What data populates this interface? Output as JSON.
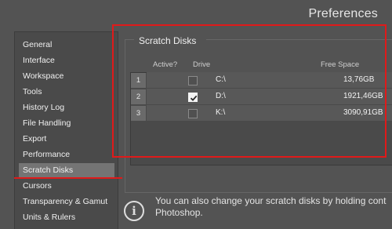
{
  "window": {
    "title": "Preferences"
  },
  "sidebar": {
    "items": [
      {
        "label": "General"
      },
      {
        "label": "Interface"
      },
      {
        "label": "Workspace"
      },
      {
        "label": "Tools"
      },
      {
        "label": "History Log"
      },
      {
        "label": "File Handling"
      },
      {
        "label": "Export"
      },
      {
        "label": "Performance"
      },
      {
        "label": "Scratch Disks",
        "active": true
      },
      {
        "label": "Cursors"
      },
      {
        "label": "Transparency & Gamut"
      },
      {
        "label": "Units & Rulers"
      }
    ]
  },
  "scratch": {
    "title": "Scratch Disks",
    "headers": {
      "active": "Active?",
      "drive": "Drive",
      "free": "Free Space"
    },
    "rows": [
      {
        "num": "1",
        "active": false,
        "drive": "C:\\",
        "free": "13,76GB"
      },
      {
        "num": "2",
        "active": true,
        "drive": "D:\\",
        "free": "1921,46GB"
      },
      {
        "num": "3",
        "active": false,
        "drive": "K:\\",
        "free": "3090,91GB"
      }
    ]
  },
  "info": {
    "icon": "info-icon",
    "line1": "You can also change your scratch disks by holding cont",
    "line2": "Photoshop."
  },
  "colors": {
    "highlight": "#e01a1a",
    "selected_item": "#747474",
    "background": "#535353"
  }
}
